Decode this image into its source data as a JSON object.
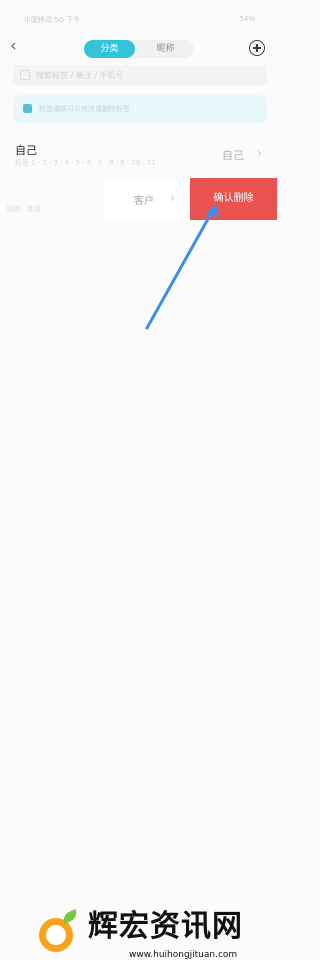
{
  "status_bar": {
    "left": "中国移动 5G 下午",
    "right": "54%"
  },
  "nav": {
    "segments": [
      "分类",
      "昵称"
    ]
  },
  "search": {
    "placeholder": "搜索标签 / 备注 / 手机号"
  },
  "notice": {
    "text": "标签编辑可以修改或删除标签"
  },
  "list": {
    "title": "自己",
    "subtitle": "标签 1 · 2 · 3 · 4 · 5 · 6 · 7 · 8 · 9 · 10 · 11",
    "value": "自己"
  },
  "swipe": {
    "client_label": "客户",
    "delete_label": "确认删除"
  },
  "side": {
    "label": "其他 · 其他"
  },
  "watermark": {
    "title": "辉宏资讯网",
    "url": "www.huihongjituan.com"
  },
  "colors": {
    "accent": "#35c3d8",
    "danger": "#e9524f",
    "arrow": "#3b8ee8"
  }
}
